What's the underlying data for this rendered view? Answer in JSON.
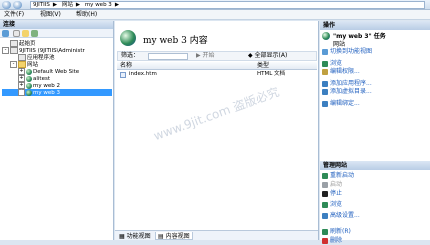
{
  "address": {
    "back_icon": "back-arrow-icon",
    "forward_icon": "forward-arrow-icon",
    "breadcrumbs": [
      "9JITIIS",
      "网站",
      "my web 3"
    ]
  },
  "menu": [
    "文件(F)",
    "视图(V)",
    "帮助(H)"
  ],
  "connections": {
    "title": "连接",
    "tree": [
      {
        "label": "起始页",
        "indent": 0,
        "icon": "start-page-icon",
        "expander": ""
      },
      {
        "label": "9JITIIS (9JITIIS\\Administr",
        "indent": 0,
        "icon": "server-icon",
        "expander": "-"
      },
      {
        "label": "应用程序池",
        "indent": 1,
        "icon": "app-pool-icon",
        "expander": ""
      },
      {
        "label": "网站",
        "indent": 1,
        "icon": "sites-folder-icon",
        "expander": "-"
      },
      {
        "label": "Default Web Site",
        "indent": 2,
        "icon": "globe-icon",
        "expander": "+"
      },
      {
        "label": "alitest",
        "indent": 2,
        "icon": "globe-icon",
        "expander": "+"
      },
      {
        "label": "my web 2",
        "indent": 2,
        "icon": "globe-icon",
        "expander": "+"
      },
      {
        "label": "my web 3",
        "indent": 2,
        "icon": "globe-icon",
        "expander": "+",
        "selected": true
      }
    ]
  },
  "content": {
    "title": "my web 3 内容",
    "filter_label": "筛选：",
    "go_label": "开始",
    "show_all_label": "全部显示(A)",
    "columns": [
      "名称",
      "类型"
    ],
    "rows": [
      {
        "name": "index.htm",
        "type": "HTML 文档"
      }
    ],
    "tabs": [
      "功能视图",
      "内容视图"
    ]
  },
  "actions": {
    "title": "操作",
    "group1_title": "\"my web 3\" 任务",
    "group1_sub": "网站",
    "items1": [
      "切换到功能视图",
      "浏览",
      "编辑权限...",
      "添加应用程序...",
      "添加虚拟目录...",
      "编辑绑定..."
    ],
    "manage_title": "管理网站",
    "items2": [
      "重新启动",
      "启动",
      "停止",
      "浏览",
      "高级设置...",
      "刷新(R)",
      "删除"
    ]
  },
  "watermark": "www.9jit.com  盗版必究"
}
